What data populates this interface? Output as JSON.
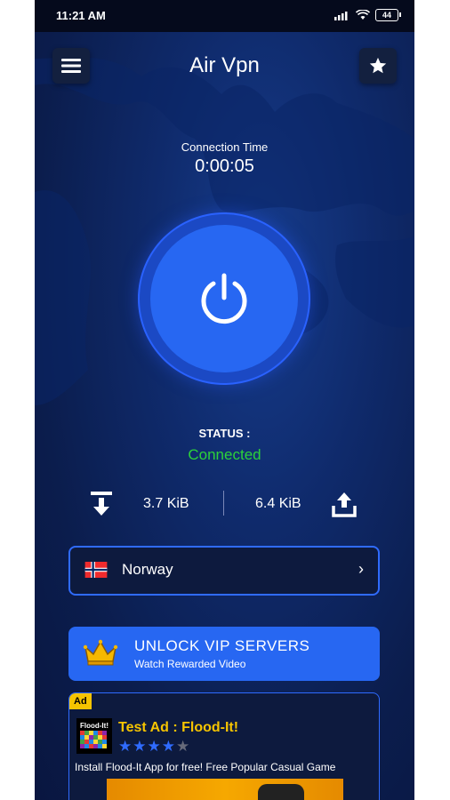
{
  "status_bar": {
    "time": "11:21 AM",
    "battery": "44"
  },
  "app": {
    "title": "Air Vpn"
  },
  "connection": {
    "label": "Connection Time",
    "time": "0:00:05"
  },
  "status": {
    "label": "STATUS :",
    "value": "Connected",
    "color": "#2cd23a"
  },
  "traffic": {
    "download": "3.7 KiB",
    "upload": "6.4 KiB"
  },
  "server": {
    "name": "Norway",
    "flag": "norway-flag"
  },
  "vip": {
    "title": "UNLOCK VIP SERVERS",
    "subtitle": "Watch Rewarded Video"
  },
  "ad": {
    "tag": "Ad",
    "app_name": "Flood-It!",
    "title": "Test Ad : Flood-It!",
    "rating": 4,
    "rating_max": 5,
    "description": "Install Flood-It App for free! Free Popular Casual Game"
  },
  "colors": {
    "accent": "#2767f2",
    "background": "#0b1d4d",
    "ad_title": "#f6c400"
  }
}
